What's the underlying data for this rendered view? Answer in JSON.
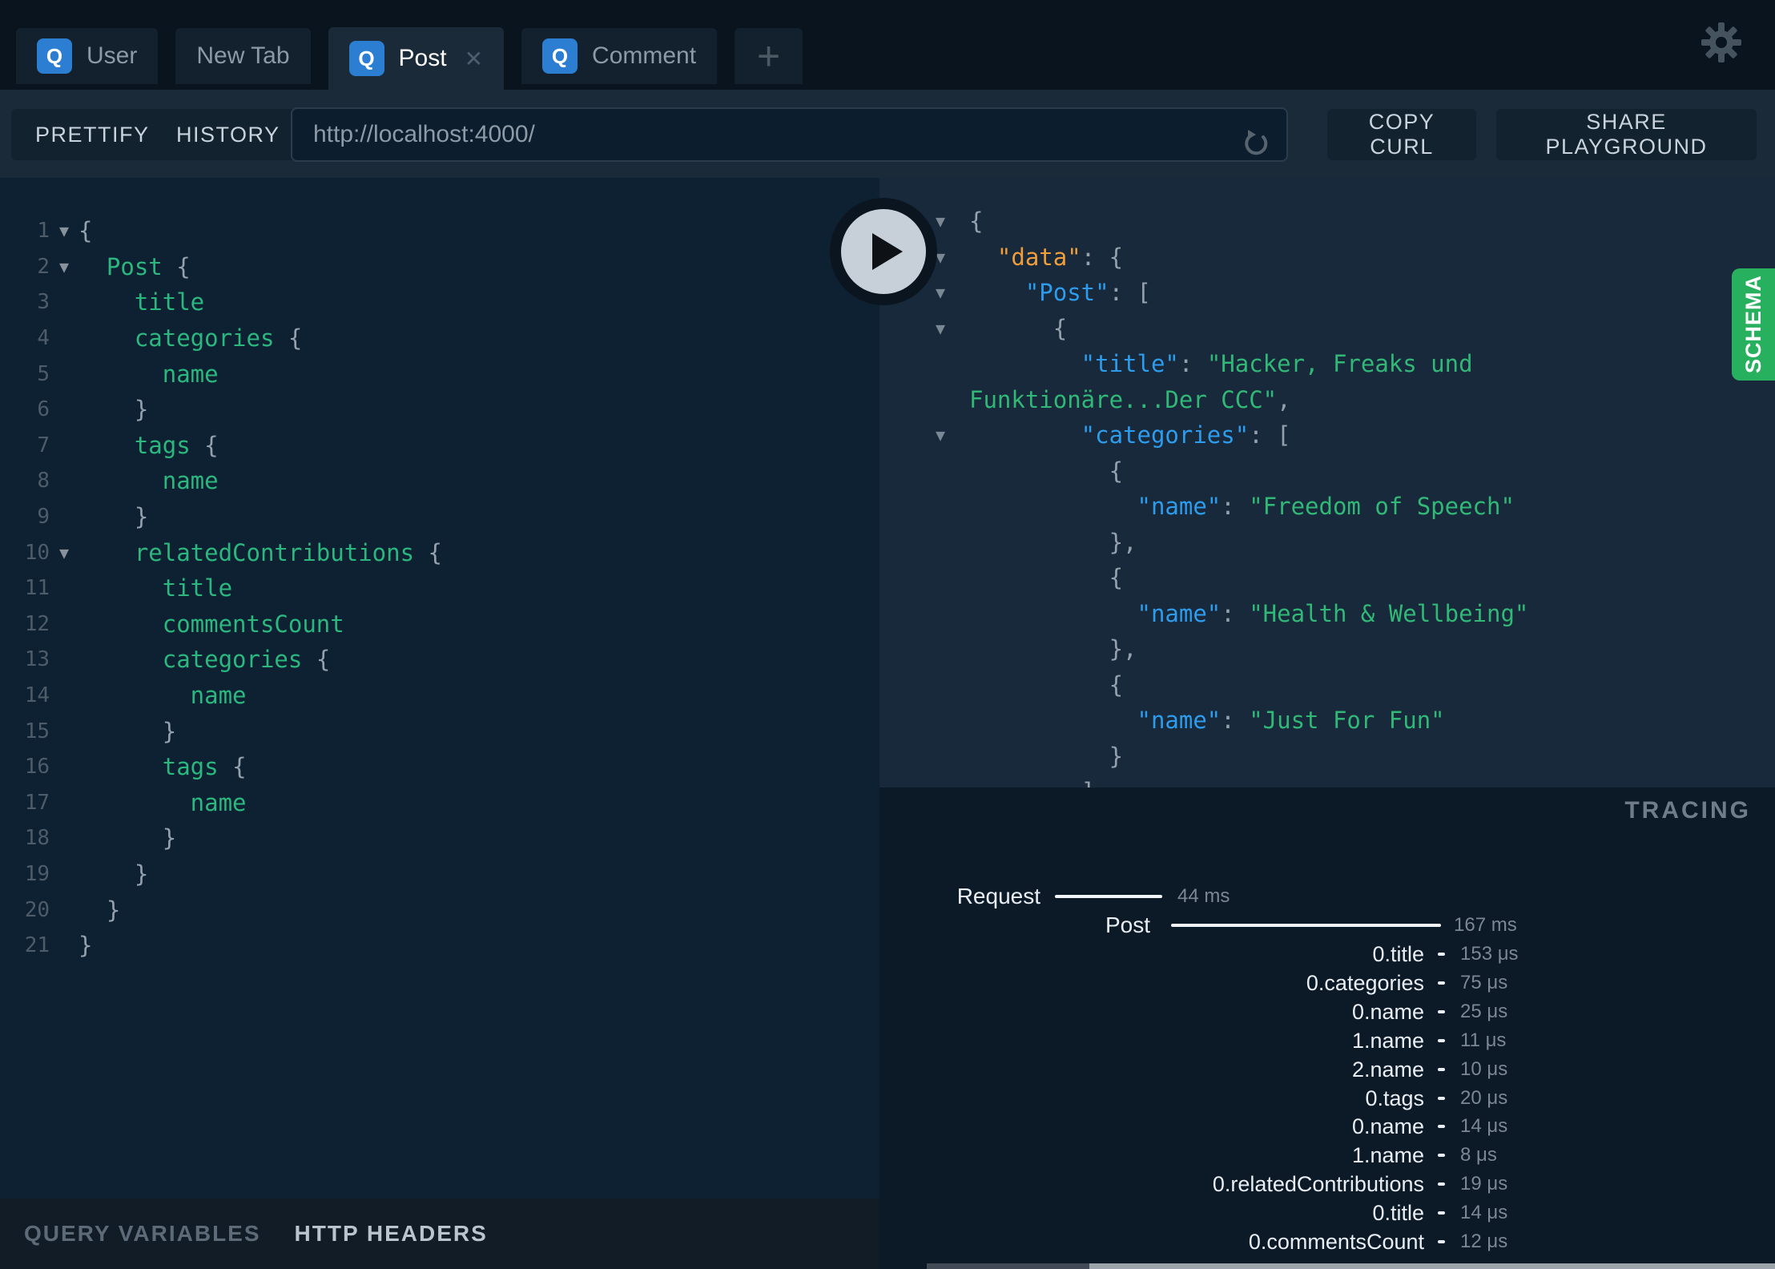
{
  "tabs": [
    {
      "badge": "Q",
      "label": "User",
      "active": false,
      "closable": false
    },
    {
      "badge": null,
      "label": "New Tab",
      "active": false,
      "closable": false
    },
    {
      "badge": "Q",
      "label": "Post",
      "active": true,
      "closable": true
    },
    {
      "badge": "Q",
      "label": "Comment",
      "active": false,
      "closable": false
    }
  ],
  "new_tab_button": "+",
  "toolbar": {
    "prettify": "PRETTIFY",
    "history": "HISTORY",
    "url": "http://localhost:4000/",
    "copy_curl": "COPY CURL",
    "share_playground": "SHARE PLAYGROUND"
  },
  "query_editor": {
    "lines": [
      {
        "n": 1,
        "fold": true,
        "tokens": [
          [
            "p",
            "{"
          ]
        ]
      },
      {
        "n": 2,
        "fold": true,
        "tokens": [
          [
            "g",
            "  Post"
          ],
          [
            "p",
            " {"
          ]
        ]
      },
      {
        "n": 3,
        "fold": false,
        "tokens": [
          [
            "g",
            "    title"
          ]
        ]
      },
      {
        "n": 4,
        "fold": false,
        "tokens": [
          [
            "g",
            "    categories"
          ],
          [
            "p",
            " {"
          ]
        ]
      },
      {
        "n": 5,
        "fold": false,
        "tokens": [
          [
            "g",
            "      name"
          ]
        ]
      },
      {
        "n": 6,
        "fold": false,
        "tokens": [
          [
            "p",
            "    }"
          ]
        ]
      },
      {
        "n": 7,
        "fold": false,
        "tokens": [
          [
            "g",
            "    tags"
          ],
          [
            "p",
            " {"
          ]
        ]
      },
      {
        "n": 8,
        "fold": false,
        "tokens": [
          [
            "g",
            "      name"
          ]
        ]
      },
      {
        "n": 9,
        "fold": false,
        "tokens": [
          [
            "p",
            "    }"
          ]
        ]
      },
      {
        "n": 10,
        "fold": true,
        "tokens": [
          [
            "g",
            "    relatedContributions"
          ],
          [
            "p",
            " {"
          ]
        ]
      },
      {
        "n": 11,
        "fold": false,
        "tokens": [
          [
            "g",
            "      title"
          ]
        ]
      },
      {
        "n": 12,
        "fold": false,
        "tokens": [
          [
            "g",
            "      commentsCount"
          ]
        ]
      },
      {
        "n": 13,
        "fold": false,
        "tokens": [
          [
            "g",
            "      categories"
          ],
          [
            "p",
            " {"
          ]
        ]
      },
      {
        "n": 14,
        "fold": false,
        "tokens": [
          [
            "g",
            "        name"
          ]
        ]
      },
      {
        "n": 15,
        "fold": false,
        "tokens": [
          [
            "p",
            "      }"
          ]
        ]
      },
      {
        "n": 16,
        "fold": false,
        "tokens": [
          [
            "g",
            "      tags"
          ],
          [
            "p",
            " {"
          ]
        ]
      },
      {
        "n": 17,
        "fold": false,
        "tokens": [
          [
            "g",
            "        name"
          ]
        ]
      },
      {
        "n": 18,
        "fold": false,
        "tokens": [
          [
            "p",
            "      }"
          ]
        ]
      },
      {
        "n": 19,
        "fold": false,
        "tokens": [
          [
            "p",
            "    }"
          ]
        ]
      },
      {
        "n": 20,
        "fold": false,
        "tokens": [
          [
            "p",
            "  }"
          ]
        ]
      },
      {
        "n": 21,
        "fold": false,
        "tokens": [
          [
            "p",
            "}"
          ]
        ]
      }
    ]
  },
  "response": {
    "lines": [
      {
        "fold": true,
        "tokens": [
          [
            "p",
            "{"
          ]
        ]
      },
      {
        "fold": true,
        "tokens": [
          [
            "o",
            "  \"data\""
          ],
          [
            "p",
            ": {"
          ]
        ]
      },
      {
        "fold": true,
        "tokens": [
          [
            "b",
            "    \"Post\""
          ],
          [
            "p",
            ": ["
          ]
        ]
      },
      {
        "fold": true,
        "tokens": [
          [
            "p",
            "      {"
          ]
        ]
      },
      {
        "fold": false,
        "tokens": [
          [
            "b",
            "        \"title\""
          ],
          [
            "p",
            ": "
          ],
          [
            "s",
            "\"Hacker, Freaks und"
          ]
        ]
      },
      {
        "fold": false,
        "tokens": [
          [
            "s",
            "Funktionäre...Der CCC\""
          ],
          [
            "p",
            ","
          ]
        ]
      },
      {
        "fold": true,
        "tokens": [
          [
            "b",
            "        \"categories\""
          ],
          [
            "p",
            ": ["
          ]
        ]
      },
      {
        "fold": false,
        "tokens": [
          [
            "p",
            "          {"
          ]
        ]
      },
      {
        "fold": false,
        "tokens": [
          [
            "b",
            "            \"name\""
          ],
          [
            "p",
            ": "
          ],
          [
            "s",
            "\"Freedom of Speech\""
          ]
        ]
      },
      {
        "fold": false,
        "tokens": [
          [
            "p",
            "          },"
          ]
        ]
      },
      {
        "fold": false,
        "tokens": [
          [
            "p",
            "          {"
          ]
        ]
      },
      {
        "fold": false,
        "tokens": [
          [
            "b",
            "            \"name\""
          ],
          [
            "p",
            ": "
          ],
          [
            "s",
            "\"Health & Wellbeing\""
          ]
        ]
      },
      {
        "fold": false,
        "tokens": [
          [
            "p",
            "          },"
          ]
        ]
      },
      {
        "fold": false,
        "tokens": [
          [
            "p",
            "          {"
          ]
        ]
      },
      {
        "fold": false,
        "tokens": [
          [
            "b",
            "            \"name\""
          ],
          [
            "p",
            ": "
          ],
          [
            "s",
            "\"Just For Fun\""
          ]
        ]
      },
      {
        "fold": false,
        "tokens": [
          [
            "p",
            "          }"
          ]
        ]
      },
      {
        "fold": false,
        "tokens": [
          [
            "p",
            "        ]"
          ]
        ]
      }
    ]
  },
  "schema_button": {
    "label": "SCHEMA"
  },
  "tracing": {
    "title": "TRACING",
    "request": {
      "label": "Request",
      "time": "44 ms"
    },
    "root": {
      "label": "Post",
      "time": "167 ms"
    },
    "resolvers": [
      {
        "label": "0.title",
        "time": "153 μs"
      },
      {
        "label": "0.categories",
        "time": "75 μs"
      },
      {
        "label": "0.name",
        "time": "25 μs"
      },
      {
        "label": "1.name",
        "time": "11 μs"
      },
      {
        "label": "2.name",
        "time": "10 μs"
      },
      {
        "label": "0.tags",
        "time": "20 μs"
      },
      {
        "label": "0.name",
        "time": "14 μs"
      },
      {
        "label": "1.name",
        "time": "8 μs"
      },
      {
        "label": "0.relatedContributions",
        "time": "19 μs"
      },
      {
        "label": "0.title",
        "time": "14 μs"
      },
      {
        "label": "0.commentsCount",
        "time": "12 μs"
      }
    ]
  },
  "bottom_bar": {
    "query_variables": "QUERY VARIABLES",
    "http_headers": "HTTP HEADERS"
  },
  "colors": {
    "schema_green": "#27b05e",
    "badge_blue": "#2b7ed1",
    "field_green": "#2bb77e",
    "key_blue": "#2e9cec",
    "string_green": "#31b877",
    "data_orange": "#f09d3b",
    "editor_bg": "#0d2133",
    "response_bg": "#17293b",
    "tracing_bg": "#0c1927"
  }
}
